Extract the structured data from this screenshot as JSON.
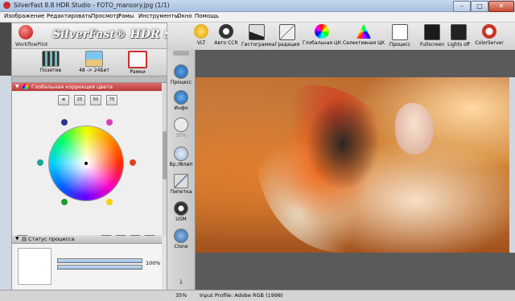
{
  "window": {
    "title": "SilverFast 8.8 HDR Studio - FOTO_mansory.jpg (1/1)",
    "minimize_glyph": "–",
    "maximize_glyph": "□",
    "close_glyph": "✕"
  },
  "menu": [
    "Изображение",
    "Редактировать",
    "Просмотр",
    "Рамы",
    "Инструменты",
    "Окно",
    "Помощь"
  ],
  "header": {
    "workflowpilot_label": "WorkflowPilot",
    "brand": "SilverFast® HDR Studio"
  },
  "left_tools": [
    {
      "label": "Позитив",
      "icon": "film-strip-icon"
    },
    {
      "label": "48 -> 24Бит",
      "icon": "palm-landscape-icon"
    },
    {
      "label": "Рамки",
      "icon": "tools-icon"
    }
  ],
  "toolbar": [
    {
      "label": "VLT",
      "icon": "light-bulb-icon"
    },
    {
      "label": "Авто CCR",
      "icon": "auto-ccr-icon"
    },
    {
      "label": "Гистограмма",
      "icon": "histogram-icon"
    },
    {
      "label": "Градация",
      "icon": "gradation-icon"
    },
    {
      "label": "Глобальная ЦК",
      "icon": "color-wheel-icon"
    },
    {
      "label": "Селективная ЦК",
      "icon": "selective-color-icon"
    },
    {
      "label": "Процесс",
      "icon": "process-icon"
    },
    {
      "label": "Fullscreen",
      "icon": "fullscreen-icon"
    },
    {
      "label": "Lights off",
      "icon": "lights-off-icon"
    },
    {
      "label": "ColorServer",
      "icon": "colorserver-icon"
    }
  ],
  "side_tools": [
    {
      "label": "Процесс",
      "icon": "process-arrow-icon"
    },
    {
      "label": "Инфо",
      "icon": "info-icon"
    },
    {
      "label": "35%",
      "icon": "zoom-icon"
    },
    {
      "label": "Вр./Флип",
      "icon": "rotate-flip-icon"
    },
    {
      "label": "Пипетка",
      "icon": "eyedropper-icon"
    },
    {
      "label": "USM",
      "icon": "usm-icon"
    },
    {
      "label": "Clone",
      "icon": "clone-icon"
    }
  ],
  "gcc_panel": {
    "title": "Глобальная коррекция цвета",
    "mini_buttons": [
      "",
      "25",
      "50",
      "75"
    ]
  },
  "process_panel": {
    "title": "Статус процесса",
    "progress_percent": "100%",
    "progress_fraction": 1.0
  },
  "statusbar": {
    "zoom": "35%",
    "profile": "Input Profile: Adobe RGB (1998)"
  }
}
